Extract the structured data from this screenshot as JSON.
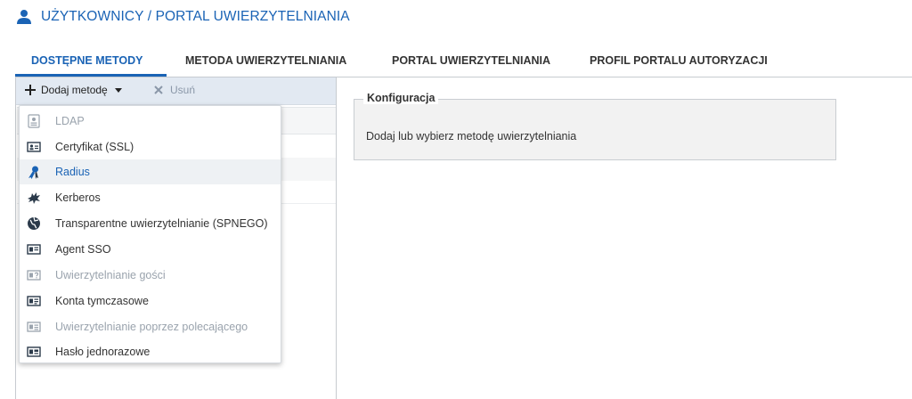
{
  "header": {
    "title": "UŻYTKOWNICY / PORTAL UWIERZYTELNIANIA",
    "icon": "user-icon"
  },
  "tabs": [
    {
      "label": "DOSTĘPNE METODY",
      "active": true
    },
    {
      "label": "METODA UWIERZYTELNIANIA",
      "active": false
    },
    {
      "label": "PORTAL UWIERZYTELNIANIA",
      "active": false
    },
    {
      "label": "PROFIL PORTALU AUTORYZACJI",
      "active": false
    }
  ],
  "toolbar": {
    "add_label": "Dodaj metodę",
    "remove_label": "Usuń"
  },
  "dropdown": {
    "items": [
      {
        "label": "LDAP",
        "icon": "ldap-icon",
        "disabled": true
      },
      {
        "label": "Certyfikat (SSL)",
        "icon": "certificate-icon",
        "disabled": false
      },
      {
        "label": "Radius",
        "icon": "radius-icon",
        "disabled": false,
        "hover": true
      },
      {
        "label": "Kerberos",
        "icon": "kerberos-icon",
        "disabled": false
      },
      {
        "label": "Transparentne uwierzytelnianie (SPNEGO)",
        "icon": "spnego-icon",
        "disabled": false
      },
      {
        "label": "Agent SSO",
        "icon": "agent-sso-icon",
        "disabled": false
      },
      {
        "label": "Uwierzytelnianie gości",
        "icon": "guest-icon",
        "disabled": true
      },
      {
        "label": "Konta tymczasowe",
        "icon": "temporary-account-icon",
        "disabled": false
      },
      {
        "label": "Uwierzytelnianie poprzez polecającego",
        "icon": "sponsor-icon",
        "disabled": true
      },
      {
        "label": "Hasło jednorazowe",
        "icon": "one-time-password-icon",
        "disabled": false
      }
    ]
  },
  "config": {
    "legend": "Konfiguracja",
    "text": "Dodaj lub wybierz metodę uwierzytelniania"
  },
  "colors": {
    "accent": "#1a63b5",
    "toolbar_bg": "#e2e9f2",
    "disabled_text": "#9aa3ad"
  }
}
